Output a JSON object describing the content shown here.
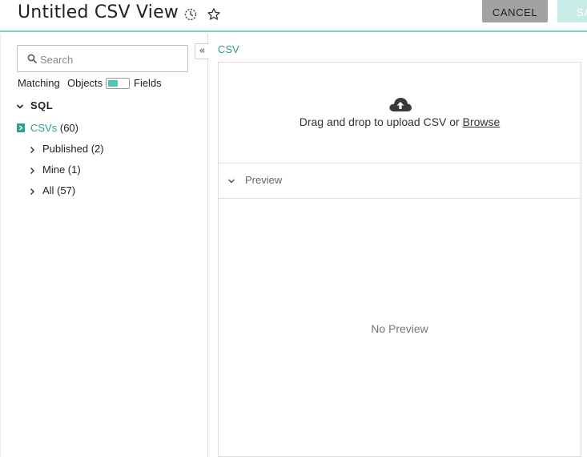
{
  "header": {
    "title": "Untitled CSV View",
    "history_icon": "history-icon",
    "star_icon": "star-icon",
    "cancel_label": "CANCEL",
    "save_label": "SA"
  },
  "sidebar": {
    "search": {
      "placeholder": "Search",
      "value": ""
    },
    "collapse_icon": "double-chevron-left-icon",
    "toggle": {
      "label": "Matching",
      "left_option": "Objects",
      "right_option": "Fields"
    },
    "tree": {
      "root_label": "SQL",
      "csvs": {
        "label": "CSVs",
        "count": "(60)"
      },
      "children": [
        {
          "label": "Published (2)"
        },
        {
          "label": "Mine (1)"
        },
        {
          "label": "All (57)"
        }
      ]
    }
  },
  "main": {
    "tab_label": "CSV",
    "upload": {
      "text": "Drag and drop to upload CSV or",
      "browse_label": "Browse",
      "icon": "cloud-upload-icon"
    },
    "preview": {
      "label": "Preview",
      "empty_text": "No Preview"
    }
  },
  "colors": {
    "accent": "#2e9e8f",
    "toggle_fill": "#4fc3b4",
    "header_border": "#7fcfc3",
    "cancel_bg": "#a2a2a2",
    "save_bg": "#c7ece6"
  }
}
